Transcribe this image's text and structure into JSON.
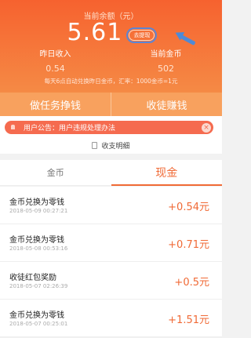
{
  "balance": {
    "label": "当前余额（元）",
    "value": "5.61",
    "withdraw_label": "去提现"
  },
  "stats": {
    "yesterday_label": "昨日收入",
    "yesterday_value": "0.54",
    "coins_label": "当前金币",
    "coins_value": "502"
  },
  "note": "每天6点自动兑换昨日金币，汇率：1000金币=1元",
  "actions": {
    "tasks_label": "做任务挣钱",
    "apprentice_label": "收徒赚钱"
  },
  "notice": {
    "text": "用户公告：用户违规处理办法",
    "close_glyph": "×"
  },
  "ledger_label": "收支明细",
  "tabs": [
    {
      "label": "金币"
    },
    {
      "label": "现金"
    }
  ],
  "records": [
    {
      "title": "金币兑换为零钱",
      "time": "2018-05-09 00:27:21",
      "amount": "+0.54元"
    },
    {
      "title": "金币兑换为零钱",
      "time": "2018-05-08 00:53:16",
      "amount": "+0.71元"
    },
    {
      "title": "收徒红包奖励",
      "time": "2018-05-07 02:26:39",
      "amount": "+0.5元"
    },
    {
      "title": "金币兑换为零钱",
      "time": "2018-05-07 00:25:01",
      "amount": "+1.51元"
    }
  ],
  "colors": {
    "header_start": "#f6622f",
    "header_end": "#f58a45",
    "accent": "#f06a36",
    "annotation_blue": "#4f8ad6"
  }
}
